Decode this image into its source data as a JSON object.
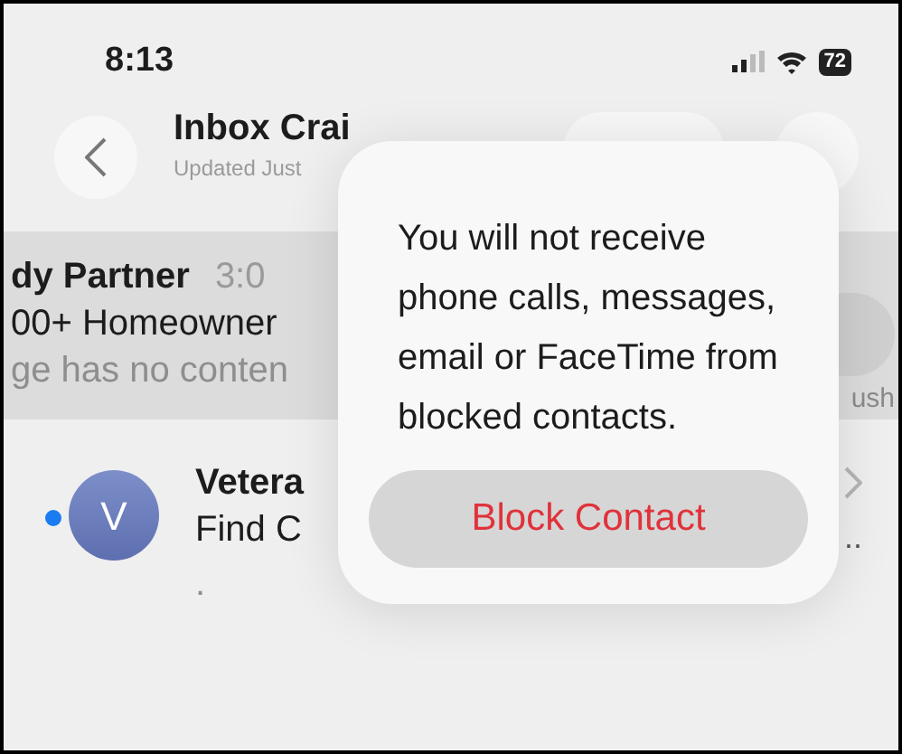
{
  "status_bar": {
    "time": "8:13",
    "battery": "72"
  },
  "nav": {
    "title": "Inbox Crai",
    "subtitle": "Updated Just"
  },
  "messages": [
    {
      "kind": "swiped",
      "sender": "dy Partner",
      "time": "3:0",
      "subject": "00+ Homeowner",
      "preview": "ge has no conten",
      "action_label": "ush"
    },
    {
      "kind": "normal",
      "unread": true,
      "avatar": "V",
      "sender": "Vetera",
      "subject": "Find C",
      "preview": ".",
      "more": ".."
    }
  ],
  "alert": {
    "message": "You will not receive phone calls, messages, email or FaceTime from blocked contacts.",
    "button": "Block Contact"
  }
}
